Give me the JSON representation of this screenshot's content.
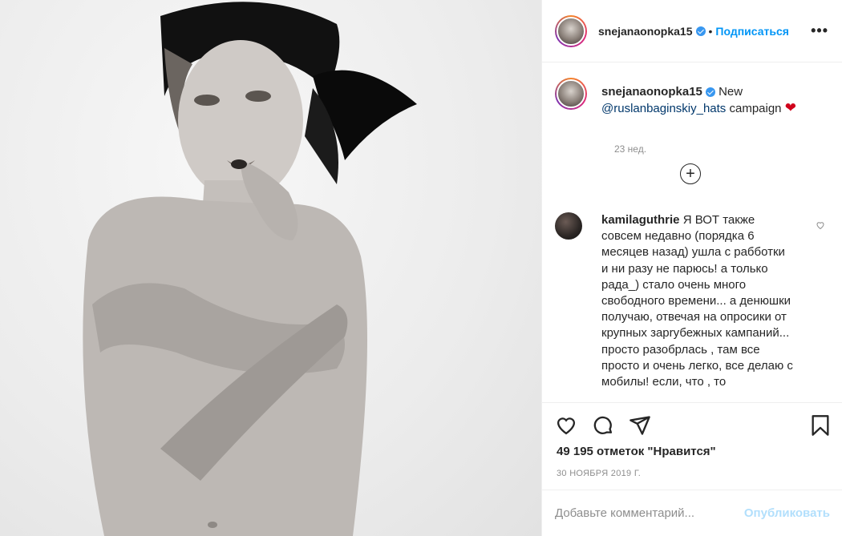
{
  "post": {
    "photo_alt": "black and white portrait photo"
  },
  "header": {
    "username": "snejanaonopka15",
    "separator": "•",
    "follow_label": "Подписаться",
    "more_label": "•••"
  },
  "caption": {
    "username": "snejanaonopka15",
    "text_before": "New",
    "mention": "@ruslanbaginskiy_hats",
    "text_after": "campaign",
    "emoji": "❤",
    "time": "23 нед."
  },
  "comment": {
    "username": "kamilaguthrie",
    "text": "Я ВОТ также совсем недавно (порядка 6 месяцев назад) ушла с рабботки и ни разу не парюсь! а только рада_) стало очень много свободного времени... а денюшки получаю, отвечая на опросики от крупных зарrубежных кампаний... просто разобрлась , там все просто и очень легко, все делаю с мобилы! если, что , то"
  },
  "actions": {
    "likes": "49 195 отметок \"Нравится\"",
    "date": "30 НОЯБРЯ 2019 Г."
  },
  "add_comment": {
    "placeholder": "Добавьте комментарий...",
    "post_label": "Опубликовать"
  },
  "colors": {
    "accent": "#0095f6",
    "verified": "#3897f0",
    "muted": "#8e8e8e",
    "post_disabled": "#b2dffc",
    "heart": "#d0021b"
  }
}
